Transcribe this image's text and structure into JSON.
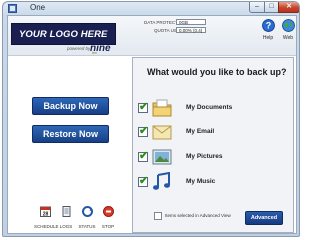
{
  "window": {
    "title": "One"
  },
  "header": {
    "logo_text": "YOUR LOGO HERE",
    "powered_by": "powered by",
    "brand": "nine",
    "brand_sub": "ten",
    "data_protected_label": "DATA PROTECTED",
    "data_protected_value": "0GB",
    "quota_used_label": "QUOTA USED",
    "quota_used_value": "0.00% (0.4)",
    "help_label": "Help",
    "web_label": "Web"
  },
  "left": {
    "backup_label": "Backup Now",
    "restore_label": "Restore Now",
    "tools": [
      {
        "label": "SCHEDULE",
        "icon": "calendar-icon",
        "badge": "28"
      },
      {
        "label": "LOGS",
        "icon": "log-icon"
      },
      {
        "label": "STATUS",
        "icon": "status-icon"
      },
      {
        "label": "STOP",
        "icon": "stop-icon"
      }
    ]
  },
  "right": {
    "title": "What would you like to back up?",
    "options": [
      {
        "label": "My Documents",
        "icon": "documents-folder-icon",
        "checked": true
      },
      {
        "label": "My Email",
        "icon": "email-icon",
        "checked": true
      },
      {
        "label": "My Pictures",
        "icon": "pictures-icon",
        "checked": true
      },
      {
        "label": "My Music",
        "icon": "music-icon",
        "checked": true
      }
    ],
    "advanced_note": "Items selected in Advanced View",
    "advanced_label": "Advanced"
  },
  "colors": {
    "accent": "#1a1f52",
    "button": "#1f4f9e",
    "check": "#2e8c1c"
  }
}
